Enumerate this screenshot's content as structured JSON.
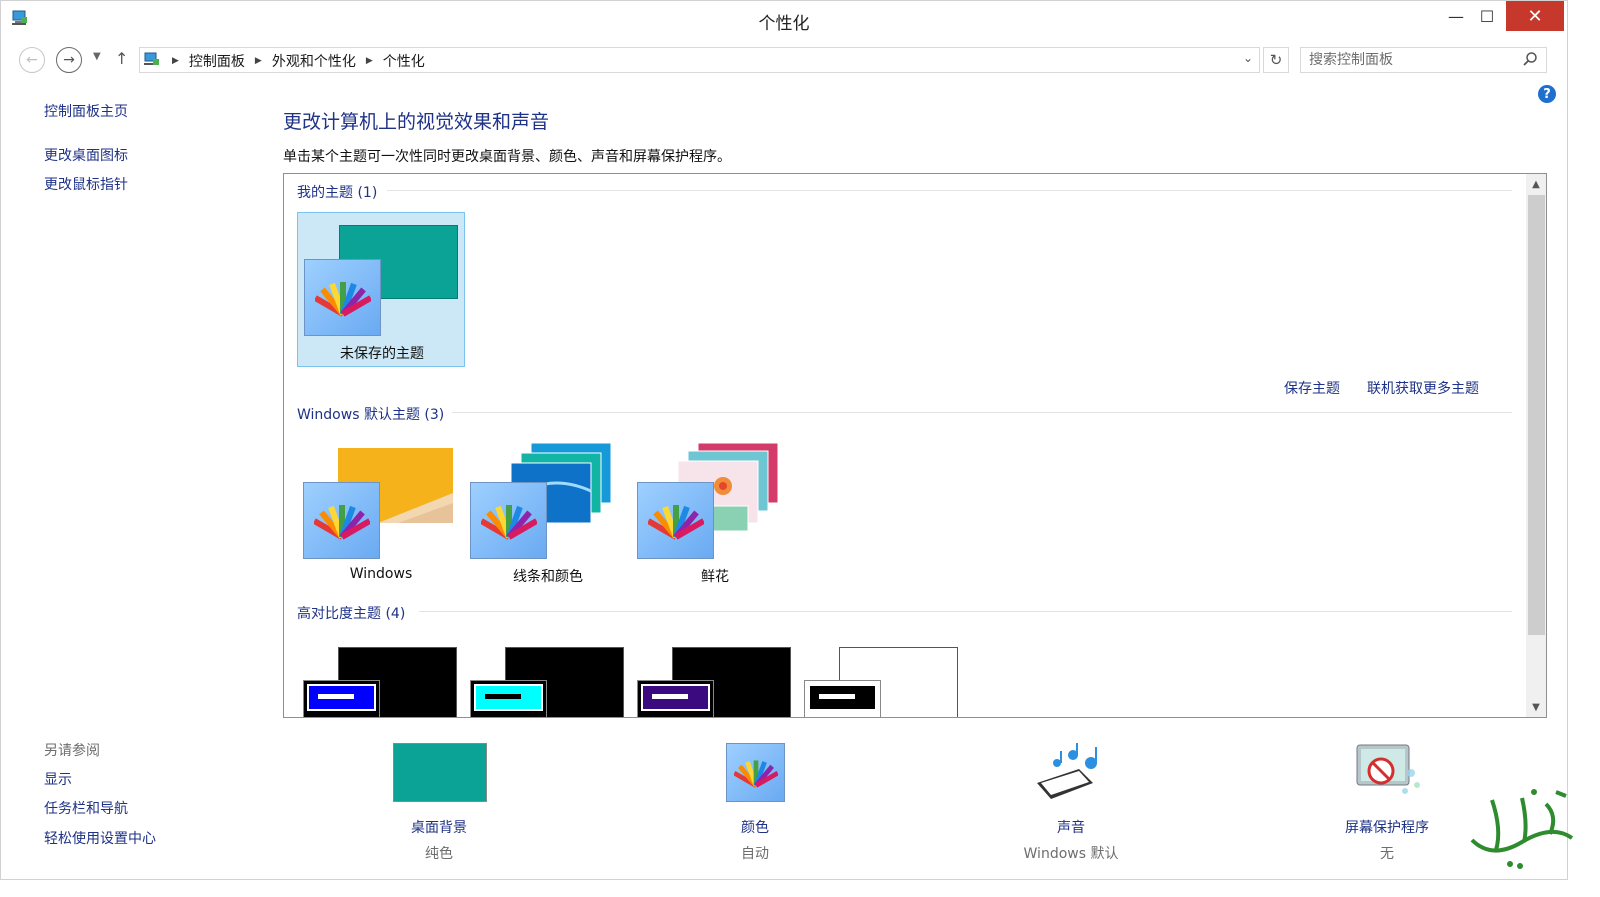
{
  "window": {
    "title": "个性化"
  },
  "titlebar": {
    "minimize": "—",
    "maximize": "☐",
    "close": "✕"
  },
  "address": {
    "crumbs": [
      "控制面板",
      "外观和个性化",
      "个性化"
    ],
    "search_placeholder": "搜索控制面板"
  },
  "leftnav": {
    "home": "控制面板主页",
    "items": [
      "更改桌面图标",
      "更改鼠标指针"
    ]
  },
  "seealso": {
    "title": "另请参阅",
    "items": [
      "显示",
      "任务栏和导航",
      "轻松使用设置中心"
    ]
  },
  "main": {
    "title": "更改计算机上的视觉效果和声音",
    "description": "单击某个主题可一次性同时更改桌面背景、颜色、声音和屏幕保护程序。"
  },
  "themes": {
    "my_section": "我的主题 (1)",
    "my_items": [
      {
        "name": "未保存的主题",
        "accent": "#0aa396"
      }
    ],
    "save_link": "保存主题",
    "online_link": "联机获取更多主题",
    "windows_section": "Windows 默认主题 (3)",
    "windows_items": [
      {
        "name": "Windows"
      },
      {
        "name": "线条和颜色"
      },
      {
        "name": "鲜花"
      }
    ],
    "hc_section": "高对比度主题 (4)",
    "hc_colors": [
      "#0000ff",
      "#00ffff",
      "#3b0a7e",
      "#000000"
    ]
  },
  "bottom": {
    "items": [
      {
        "label": "桌面背景",
        "value": "纯色",
        "color": "#0aa396"
      },
      {
        "label": "颜色",
        "value": "自动"
      },
      {
        "label": "声音",
        "value": "Windows 默认"
      },
      {
        "label": "屏幕保护程序",
        "value": "无"
      }
    ]
  }
}
